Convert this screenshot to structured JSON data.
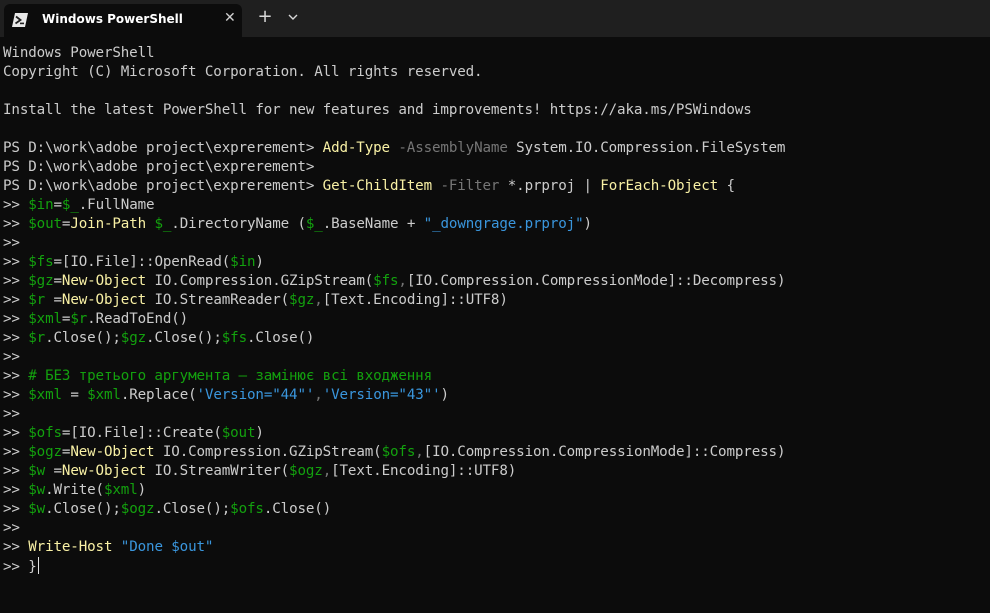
{
  "window": {
    "tab_title": "Windows PowerShell",
    "tab_icon": "powershell-icon",
    "close_icon": "close-icon",
    "new_tab_label": "+",
    "dropdown_icon": "chevron-down-icon"
  },
  "colors": {
    "background": "#0c0c0c",
    "text": "#cccccc",
    "variable": "#13a10e",
    "command": "#f9f1a5",
    "parameter": "#767676",
    "string": "#3a96dd"
  },
  "terminal": {
    "lines": [
      [
        [
          "t",
          "Windows PowerShell"
        ]
      ],
      [
        [
          "t",
          "Copyright (C) Microsoft Corporation. All rights reserved."
        ]
      ],
      [],
      [
        [
          "t",
          "Install the latest PowerShell for new features and improvements! https://aka.ms/PSWindows"
        ]
      ],
      [],
      [
        [
          "t",
          "PS D:\\work\\adobe project\\exprerement> "
        ],
        [
          "y",
          "Add-Type"
        ],
        [
          "t",
          " "
        ],
        [
          "d",
          "-AssemblyName"
        ],
        [
          "t",
          " System.IO.Compression.FileSystem"
        ]
      ],
      [
        [
          "t",
          "PS D:\\work\\adobe project\\exprerement>"
        ]
      ],
      [
        [
          "t",
          "PS D:\\work\\adobe project\\exprerement> "
        ],
        [
          "y",
          "Get-ChildItem"
        ],
        [
          "t",
          " "
        ],
        [
          "d",
          "-Filter"
        ],
        [
          "t",
          " *.prproj | "
        ],
        [
          "y",
          "ForEach-Object"
        ],
        [
          "t",
          " {"
        ]
      ],
      [
        [
          "t",
          ">> "
        ],
        [
          "g",
          "$in"
        ],
        [
          "t",
          "="
        ],
        [
          "g",
          "$_"
        ],
        [
          "t",
          ".FullName"
        ]
      ],
      [
        [
          "t",
          ">> "
        ],
        [
          "g",
          "$out"
        ],
        [
          "t",
          "="
        ],
        [
          "y",
          "Join-Path"
        ],
        [
          "t",
          " "
        ],
        [
          "g",
          "$_"
        ],
        [
          "t",
          ".DirectoryName ("
        ],
        [
          "g",
          "$_"
        ],
        [
          "t",
          ".BaseName + "
        ],
        [
          "c",
          "\"_downgrage.prproj\""
        ],
        [
          "t",
          ")"
        ]
      ],
      [
        [
          "t",
          ">>"
        ]
      ],
      [
        [
          "t",
          ">> "
        ],
        [
          "g",
          "$fs"
        ],
        [
          "t",
          "=[IO.File]::OpenRead("
        ],
        [
          "g",
          "$in"
        ],
        [
          "t",
          ")"
        ]
      ],
      [
        [
          "t",
          ">> "
        ],
        [
          "g",
          "$gz"
        ],
        [
          "t",
          "="
        ],
        [
          "y",
          "New-Object"
        ],
        [
          "t",
          " IO.Compression.GZipStream("
        ],
        [
          "g",
          "$fs"
        ],
        [
          "d",
          ","
        ],
        [
          "t",
          "[IO.Compression.CompressionMode]::Decompress)"
        ]
      ],
      [
        [
          "t",
          ">> "
        ],
        [
          "g",
          "$r"
        ],
        [
          "t",
          " ="
        ],
        [
          "y",
          "New-Object"
        ],
        [
          "t",
          " IO.StreamReader("
        ],
        [
          "g",
          "$gz"
        ],
        [
          "d",
          ","
        ],
        [
          "t",
          "[Text.Encoding]::UTF8)"
        ]
      ],
      [
        [
          "t",
          ">> "
        ],
        [
          "g",
          "$xml"
        ],
        [
          "t",
          "="
        ],
        [
          "g",
          "$r"
        ],
        [
          "t",
          ".ReadToEnd()"
        ]
      ],
      [
        [
          "t",
          ">> "
        ],
        [
          "g",
          "$r"
        ],
        [
          "t",
          ".Close();"
        ],
        [
          "g",
          "$gz"
        ],
        [
          "t",
          ".Close();"
        ],
        [
          "g",
          "$fs"
        ],
        [
          "t",
          ".Close()"
        ]
      ],
      [
        [
          "t",
          ">>"
        ]
      ],
      [
        [
          "t",
          ">> "
        ],
        [
          "g",
          "# БЕЗ третього аргумента — замінює всі входження"
        ]
      ],
      [
        [
          "t",
          ">> "
        ],
        [
          "g",
          "$xml"
        ],
        [
          "t",
          " = "
        ],
        [
          "g",
          "$xml"
        ],
        [
          "t",
          ".Replace("
        ],
        [
          "c",
          "'Version=\"44\"'"
        ],
        [
          "d",
          ","
        ],
        [
          "c",
          "'Version=\"43\"'"
        ],
        [
          "t",
          ")"
        ]
      ],
      [
        [
          "t",
          ">>"
        ]
      ],
      [
        [
          "t",
          ">> "
        ],
        [
          "g",
          "$ofs"
        ],
        [
          "t",
          "=[IO.File]::Create("
        ],
        [
          "g",
          "$out"
        ],
        [
          "t",
          ")"
        ]
      ],
      [
        [
          "t",
          ">> "
        ],
        [
          "g",
          "$ogz"
        ],
        [
          "t",
          "="
        ],
        [
          "y",
          "New-Object"
        ],
        [
          "t",
          " IO.Compression.GZipStream("
        ],
        [
          "g",
          "$ofs"
        ],
        [
          "d",
          ","
        ],
        [
          "t",
          "[IO.Compression.CompressionMode]::Compress)"
        ]
      ],
      [
        [
          "t",
          ">> "
        ],
        [
          "g",
          "$w"
        ],
        [
          "t",
          " ="
        ],
        [
          "y",
          "New-Object"
        ],
        [
          "t",
          " IO.StreamWriter("
        ],
        [
          "g",
          "$ogz"
        ],
        [
          "d",
          ","
        ],
        [
          "t",
          "[Text.Encoding]::UTF8)"
        ]
      ],
      [
        [
          "t",
          ">> "
        ],
        [
          "g",
          "$w"
        ],
        [
          "t",
          ".Write("
        ],
        [
          "g",
          "$xml"
        ],
        [
          "t",
          ")"
        ]
      ],
      [
        [
          "t",
          ">> "
        ],
        [
          "g",
          "$w"
        ],
        [
          "t",
          ".Close();"
        ],
        [
          "g",
          "$ogz"
        ],
        [
          "t",
          ".Close();"
        ],
        [
          "g",
          "$ofs"
        ],
        [
          "t",
          ".Close()"
        ]
      ],
      [
        [
          "t",
          ">>"
        ]
      ],
      [
        [
          "t",
          ">> "
        ],
        [
          "y",
          "Write-Host"
        ],
        [
          "t",
          " "
        ],
        [
          "c",
          "\"Done $out\""
        ]
      ],
      [
        [
          "t",
          ">> }"
        ]
      ]
    ]
  }
}
